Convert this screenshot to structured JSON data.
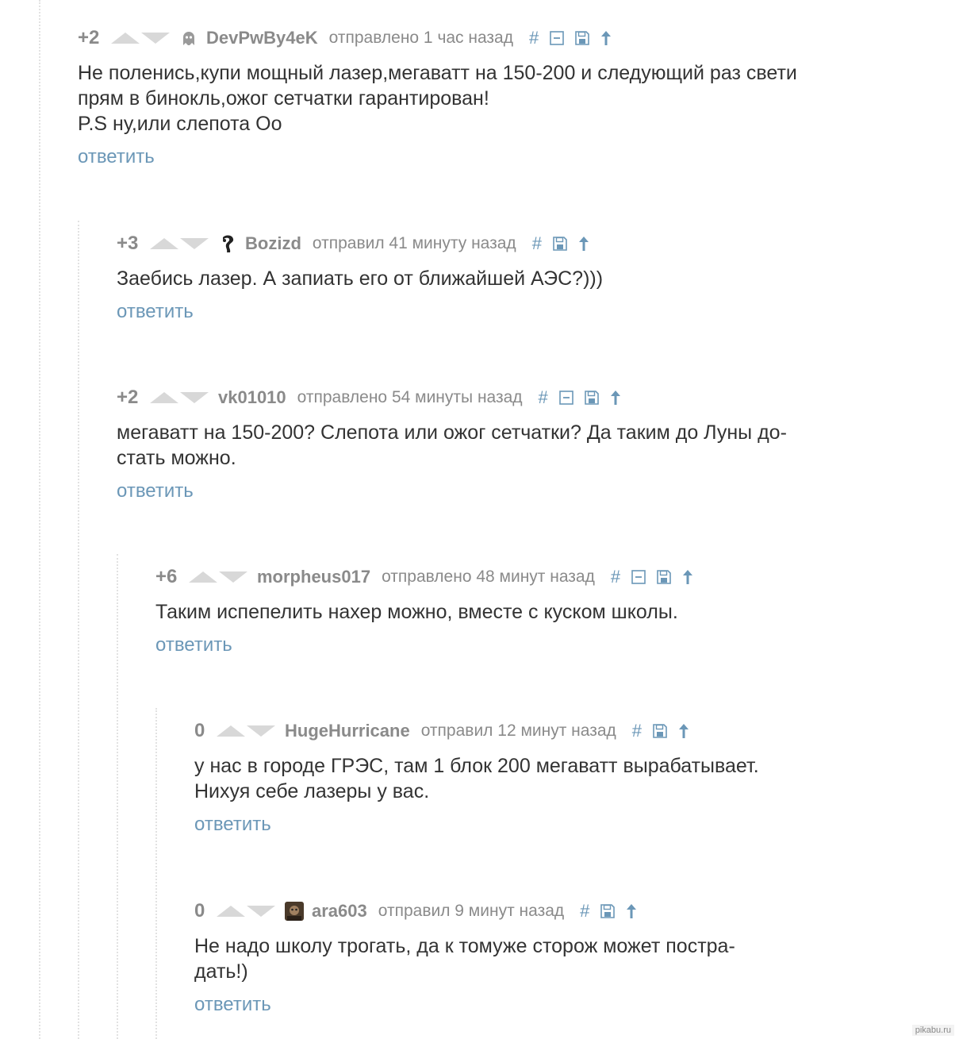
{
  "colors": {
    "accent": "#6b97b7",
    "muted": "#8a8a8a",
    "text": "#333333",
    "vote": "#d8d8d8"
  },
  "comments": [
    {
      "rating": "+2",
      "author": "DevPwBy4eK",
      "meta": "отправлено 1 час назад",
      "avatar": "ghost-avatar",
      "tools": [
        "hash-icon",
        "collapse-icon",
        "save-icon",
        "up-arrow-icon"
      ],
      "body": "Не поленись,купи мощный лазер,мегаватт на 150-200 и следующий раз свети\nпрям в бинокль,ожог сетчатки гарантирован!\nP.S ну,или слепота Оо",
      "reply": "ответить"
    },
    {
      "rating": "+3",
      "author": "Bozizd",
      "meta": "отправил 41 минуту назад",
      "avatar": "figure-avatar",
      "tools": [
        "hash-icon",
        "save-icon",
        "up-arrow-icon"
      ],
      "body": "Заебись лазер. А запиать его от ближайшей АЭС?)))",
      "reply": "ответить"
    },
    {
      "rating": "+2",
      "author": "vk01010",
      "meta": "отправлено 54 минуты назад",
      "avatar": "",
      "tools": [
        "hash-icon",
        "collapse-icon",
        "save-icon",
        "up-arrow-icon"
      ],
      "body": "мегаватт на 150-200? Слепота или ожог сетчатки? Да таким до Луны до-\nстать можно.",
      "reply": "ответить"
    },
    {
      "rating": "+6",
      "author": "morpheus017",
      "meta": "отправлено 48 минут назад",
      "avatar": "",
      "tools": [
        "hash-icon",
        "collapse-icon",
        "save-icon",
        "up-arrow-icon"
      ],
      "body": "Таким испепелить нахер можно, вместе с куском школы.",
      "reply": "ответить"
    },
    {
      "rating": "0",
      "author": "HugeHurricane",
      "meta": "отправил 12 минут назад",
      "avatar": "",
      "tools": [
        "hash-icon",
        "save-icon",
        "up-arrow-icon"
      ],
      "body": "у нас в городе ГРЭС, там 1 блок 200 мегаватт вырабатывает.\nНихуя себе лазеры у вас.",
      "reply": "ответить"
    },
    {
      "rating": "0",
      "author": "ara603",
      "meta": "отправил 9 минут назад",
      "avatar": "photo-avatar",
      "tools": [
        "hash-icon",
        "save-icon",
        "up-arrow-icon"
      ],
      "body": "Не надо школу трогать, да к томуже сторож может постра-\nдать!)",
      "reply": "ответить"
    }
  ],
  "watermark": "pikabu.ru"
}
